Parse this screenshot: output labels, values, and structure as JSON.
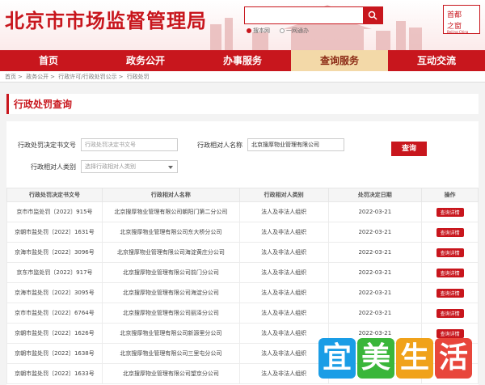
{
  "header": {
    "site_title": "北京市市场监督管理局",
    "search_placeholder": "",
    "search_options": [
      "搜本网",
      "一网通办"
    ],
    "logo_line1": "首都",
    "logo_line2": "之窗",
    "logo_line3": "Beijing China"
  },
  "nav": {
    "items": [
      {
        "label": "首页"
      },
      {
        "label": "政务公开"
      },
      {
        "label": "办事服务"
      },
      {
        "label": "查询服务"
      },
      {
        "label": "互动交流"
      }
    ],
    "active_index": 3
  },
  "breadcrumb": [
    "首页",
    "政务公开",
    "行政许可/行政处罚公示",
    "行政处罚"
  ],
  "section_title": "行政处罚查询",
  "form": {
    "decision_no_label": "行政处罚决定书文号",
    "decision_no_placeholder": "行政处罚决定书文号",
    "party_name_label": "行政相对人名称",
    "party_name_value": "北京搜厚物业管理有限公司",
    "party_type_label": "行政相对人类别",
    "party_type_placeholder": "选择行政相对人类别",
    "query_button": "查询"
  },
  "table": {
    "columns": [
      "行政处罚决定书文号",
      "行政相对人名称",
      "行政相对人类别",
      "处罚决定日期",
      "操作"
    ],
    "rows": [
      {
        "no": "京市市监处罚〔2022〕915号",
        "name": "北京搜厚物业管理有限公司朝阳门第二分公司",
        "type": "法人及非法人组织",
        "date": "2022-03-21",
        "op": "查询详情"
      },
      {
        "no": "京朝市监处罚〔2022〕1631号",
        "name": "北京搜厚物业管理有限公司东大桥分公司",
        "type": "法人及非法人组织",
        "date": "2022-03-21",
        "op": "查询详情"
      },
      {
        "no": "京海市监处罚〔2022〕3096号",
        "name": "北京搜厚物业管理有限公司海淀黄庄分公司",
        "type": "法人及非法人组织",
        "date": "2022-03-21",
        "op": "查询详情"
      },
      {
        "no": "京东市监处罚〔2022〕917号",
        "name": "北京搜厚物业管理有限公司前门分公司",
        "type": "法人及非法人组织",
        "date": "2022-03-21",
        "op": "查询详情"
      },
      {
        "no": "京海市监处罚〔2022〕3095号",
        "name": "北京搜厚物业管理有限公司海淀分公司",
        "type": "法人及非法人组织",
        "date": "2022-03-21",
        "op": "查询详情"
      },
      {
        "no": "京市市监处罚〔2022〕6764号",
        "name": "北京搜厚物业管理有限公司丽泽分公司",
        "type": "法人及非法人组织",
        "date": "2022-03-21",
        "op": "查询详情"
      },
      {
        "no": "京朝市监处罚〔2022〕1626号",
        "name": "北京搜厚物业管理有限公司新源里分公司",
        "type": "法人及非法人组织",
        "date": "2022-03-21",
        "op": "查询详情"
      },
      {
        "no": "京朝市监处罚〔2022〕1638号",
        "name": "北京搜厚物业管理有限公司三里屯分公司",
        "type": "法人及非法人组织",
        "date": "2022-03-21",
        "op": "查询详情"
      },
      {
        "no": "京朝市监处罚〔2022〕1633号",
        "name": "北京搜厚物业管理有限公司望京分公司",
        "type": "法人及非法人组织",
        "date": "2022-03-21",
        "op": "查询详情"
      }
    ]
  },
  "watermark": [
    "宜",
    "美",
    "生",
    "活"
  ],
  "colors": {
    "brand_red": "#c8161d",
    "active_tab": "#f3d9a8"
  }
}
